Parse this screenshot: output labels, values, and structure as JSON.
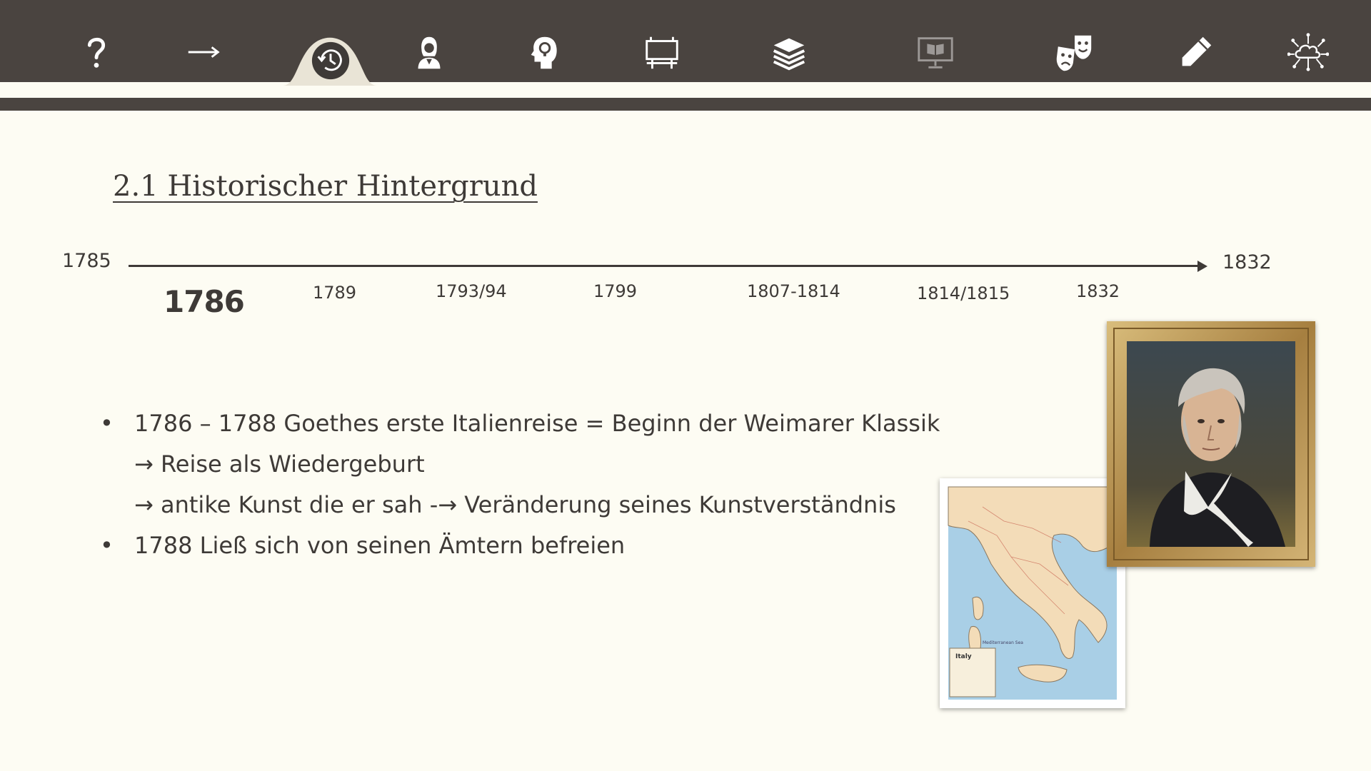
{
  "nav": {
    "items": [
      {
        "name": "question-icon"
      },
      {
        "name": "arrow-right-icon"
      },
      {
        "name": "history-icon",
        "active": true
      },
      {
        "name": "author-icon"
      },
      {
        "name": "head-idea-icon"
      },
      {
        "name": "signboard-icon"
      },
      {
        "name": "books-stack-icon"
      },
      {
        "name": "monitor-book-icon"
      },
      {
        "name": "theater-masks-icon"
      },
      {
        "name": "pencil-icon"
      },
      {
        "name": "cloud-network-icon"
      }
    ]
  },
  "slide": {
    "title": "2.1 Historischer Hintergrund"
  },
  "timeline": {
    "start": "1785",
    "end": "1832",
    "entries": [
      {
        "label": "1786",
        "selected": true
      },
      {
        "label": "1789"
      },
      {
        "label": "1793/94"
      },
      {
        "label": "1799"
      },
      {
        "label": "1807-1814"
      },
      {
        "label": "1814/1815"
      },
      {
        "label": "1832"
      }
    ]
  },
  "content": {
    "bullet_marker": "•",
    "arrow_marker": "→",
    "lines": [
      {
        "type": "bullet",
        "text": "1786 –  1788 Goethes erste Italienreise = Beginn der Weimarer Klassik"
      },
      {
        "type": "arrow",
        "text": "Reise als Wiedergeburt"
      },
      {
        "type": "arrow",
        "text": "antike Kunst die er sah -→  Veränderung seines Kunstverständnis"
      },
      {
        "type": "bullet",
        "text": "1788 Ließ sich von seinen Ämtern befreien"
      }
    ]
  },
  "images": {
    "map_label": "Italy",
    "sea_label": "Mediterranean Sea"
  },
  "colors": {
    "navbar": "#4a4440",
    "background": "#fdfcf3",
    "text": "#3e3a37",
    "icon": "#ffffff",
    "frame_gold": "#b8965a",
    "sea_blue": "#a9cfe6",
    "land_peach": "#f3dcb8"
  }
}
